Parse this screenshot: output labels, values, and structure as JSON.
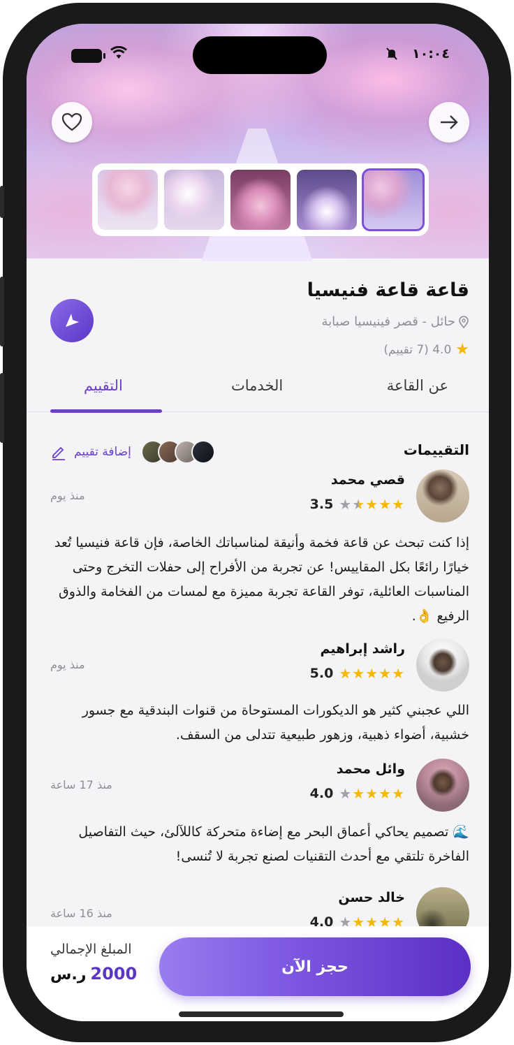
{
  "status_bar": {
    "time": "١٠:٠٤"
  },
  "venue": {
    "title": "قاعة قاعة فنيسيا",
    "location": "حائل - قصر فينيسيا صبابة",
    "rating_text": "4.0 (7 تقييم)"
  },
  "tabs": [
    {
      "label": "عن القاعة"
    },
    {
      "label": "الخدمات"
    },
    {
      "label": "التقييم"
    }
  ],
  "active_tab": "التقييم",
  "reviews_section": {
    "title": "التقييمات",
    "add_label": "إضافة تقييم"
  },
  "reviews": [
    {
      "name": "قصي محمد",
      "score": "3.5",
      "rating": 3.5,
      "time": "منذ يوم",
      "text": "إذا كنت تبحث عن قاعة فخمة وأنيقة لمناسباتك الخاصة، فإن قاعة فنيسيا تُعد خيارًا رائعًا بكل المقاييس! عن تجربة من الأفراح إلى حفلات التخرج وحتى المناسبات العائلية، توفر القاعة تجربة مميزة مع لمسات من الفخامة والذوق الرفيع 👌."
    },
    {
      "name": "راشد إبراهيم",
      "score": "5.0",
      "rating": 5,
      "time": "منذ يوم",
      "text": "اللي عجبني كثير هو الديكورات المستوحاة من قنوات البندقية مع جسور خشبية، أضواء ذهبية، وزهور طبيعية تتدلى من السقف."
    },
    {
      "name": "وائل محمد",
      "score": "4.0",
      "rating": 4,
      "time": "منذ 17 ساعة",
      "text": "🌊 تصميم يحاكي أعماق البحر مع إضاءة متحركة كاللآلئ، حيث التفاصيل الفاخرة تلتقي مع أحدث التقنيات لصنع تجربة لا تُنسى!"
    },
    {
      "name": "خالد حسن",
      "score": "4.0",
      "rating": 4,
      "time": "منذ 16 ساعة",
      "text": ""
    }
  ],
  "booking": {
    "total_label": "المبلغ الإجمالي",
    "amount": "2000",
    "currency": "ر.س",
    "book_label": "حجز الآن"
  },
  "colors": {
    "accent": "#6a3fd0",
    "star": "#f5b800"
  }
}
